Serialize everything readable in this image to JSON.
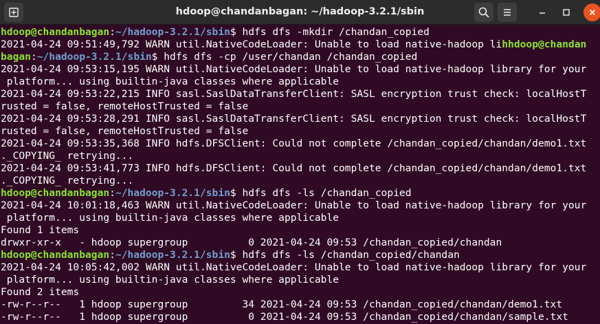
{
  "window": {
    "title": "hdoop@chandanbagan: ~/hadoop-3.2.1/sbin",
    "colors": {
      "background": "#300a24",
      "titlebar": "#2c2c2c",
      "prompt_user": "#8ae234",
      "prompt_path": "#729fcf",
      "close": "#e95420"
    },
    "icons": [
      "new-tab-icon",
      "search-icon",
      "hamburger-menu-icon",
      "minimize-icon",
      "maximize-icon",
      "close-icon"
    ]
  },
  "terminal": {
    "lines": [
      [
        {
          "t": "hdoop@chandanbagan",
          "c": "user"
        },
        {
          "t": ":",
          "c": "plain"
        },
        {
          "t": "~/hadoop-3.2.1/sbin",
          "c": "path"
        },
        {
          "t": "$ hdfs dfs -mkdir /chandan_copied",
          "c": "plain"
        }
      ],
      [
        {
          "t": "2021-04-24 09:51:49,792 WARN util.NativeCodeLoader: Unable to load native-hadoop li",
          "c": "plain"
        },
        {
          "t": "hhdoop@chandan",
          "c": "user"
        }
      ],
      [
        {
          "t": "bagan",
          "c": "user"
        },
        {
          "t": ":",
          "c": "plain"
        },
        {
          "t": "~/hadoop-3.2.1/sbin",
          "c": "path"
        },
        {
          "t": "$ hdfs dfs -cp /user/chandan /chandan_copied",
          "c": "plain"
        }
      ],
      [
        {
          "t": "2021-04-24 09:53:15,195 WARN util.NativeCodeLoader: Unable to load native-hadoop library for your",
          "c": "plain"
        }
      ],
      [
        {
          "t": " platform... using builtin-java classes where applicable",
          "c": "plain"
        }
      ],
      [
        {
          "t": "2021-04-24 09:53:22,215 INFO sasl.SaslDataTransferClient: SASL encryption trust check: localHostT",
          "c": "plain"
        }
      ],
      [
        {
          "t": "rusted = false, remoteHostTrusted = false",
          "c": "plain"
        }
      ],
      [
        {
          "t": "2021-04-24 09:53:28,291 INFO sasl.SaslDataTransferClient: SASL encryption trust check: localHostT",
          "c": "plain"
        }
      ],
      [
        {
          "t": "rusted = false, remoteHostTrusted = false",
          "c": "plain"
        }
      ],
      [
        {
          "t": "2021-04-24 09:53:35,368 INFO hdfs.DFSClient: Could not complete /chandan_copied/chandan/demo1.txt",
          "c": "plain"
        }
      ],
      [
        {
          "t": "._COPYING_ retrying...",
          "c": "plain"
        }
      ],
      [
        {
          "t": "2021-04-24 09:53:41,773 INFO hdfs.DFSClient: Could not complete /chandan_copied/chandan/demo1.txt",
          "c": "plain"
        }
      ],
      [
        {
          "t": "._COPYING_ retrying...",
          "c": "plain"
        }
      ],
      [
        {
          "t": "hdoop@chandanbagan",
          "c": "user"
        },
        {
          "t": ":",
          "c": "plain"
        },
        {
          "t": "~/hadoop-3.2.1/sbin",
          "c": "path"
        },
        {
          "t": "$ hdfs dfs -ls /chandan_copied",
          "c": "plain"
        }
      ],
      [
        {
          "t": "2021-04-24 10:01:18,463 WARN util.NativeCodeLoader: Unable to load native-hadoop library for your",
          "c": "plain"
        }
      ],
      [
        {
          "t": " platform... using builtin-java classes where applicable",
          "c": "plain"
        }
      ],
      [
        {
          "t": "Found 1 items",
          "c": "plain"
        }
      ],
      [
        {
          "t": "drwxr-xr-x   - hdoop supergroup          0 2021-04-24 09:53 /chandan_copied/chandan",
          "c": "plain"
        }
      ],
      [
        {
          "t": "hdoop@chandanbagan",
          "c": "user"
        },
        {
          "t": ":",
          "c": "plain"
        },
        {
          "t": "~/hadoop-3.2.1/sbin",
          "c": "path"
        },
        {
          "t": "$ hdfs dfs -ls /chandan_copied/chandan",
          "c": "plain"
        }
      ],
      [
        {
          "t": "2021-04-24 10:05:42,002 WARN util.NativeCodeLoader: Unable to load native-hadoop library for your",
          "c": "plain"
        }
      ],
      [
        {
          "t": " platform... using builtin-java classes where applicable",
          "c": "plain"
        }
      ],
      [
        {
          "t": "Found 2 items",
          "c": "plain"
        }
      ],
      [
        {
          "t": "-rw-r--r--   1 hdoop supergroup         34 2021-04-24 09:53 /chandan_copied/chandan/demo1.txt",
          "c": "plain"
        }
      ],
      [
        {
          "t": "-rw-r--r--   1 hdoop supergroup          0 2021-04-24 09:53 /chandan_copied/chandan/sample.txt",
          "c": "plain"
        }
      ]
    ]
  }
}
